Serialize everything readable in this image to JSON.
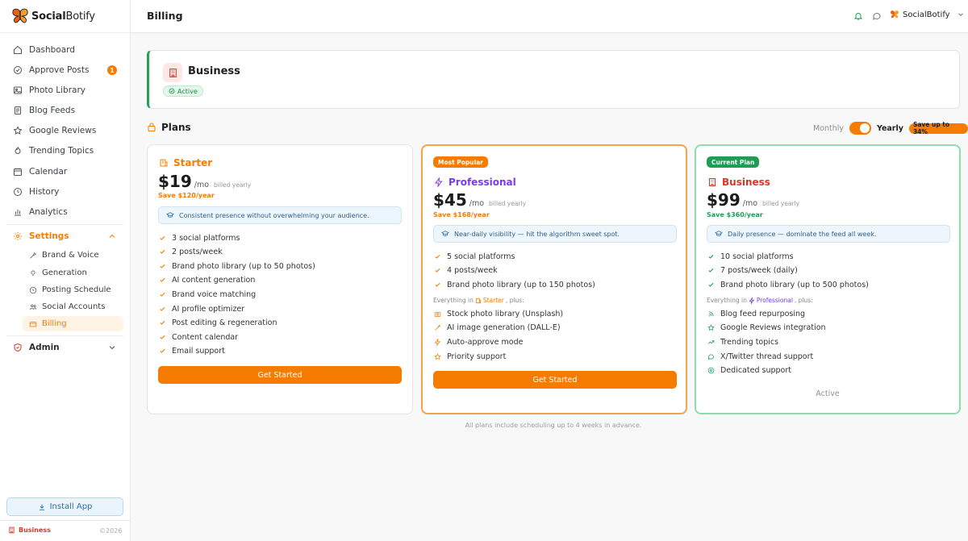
{
  "app": {
    "brand_bold": "Social",
    "brand_rest": "Botify"
  },
  "sidebar": {
    "items": [
      {
        "label": "Dashboard",
        "icon": "home-icon"
      },
      {
        "label": "Approve Posts",
        "icon": "check-circle-icon",
        "badge": "1"
      },
      {
        "label": "Photo Library",
        "icon": "image-icon"
      },
      {
        "label": "Blog Feeds",
        "icon": "document-icon"
      },
      {
        "label": "Google Reviews",
        "icon": "star-icon"
      },
      {
        "label": "Trending Topics",
        "icon": "trend-icon"
      },
      {
        "label": "Calendar",
        "icon": "calendar-icon"
      },
      {
        "label": "History",
        "icon": "clock-icon"
      },
      {
        "label": "Analytics",
        "icon": "bar-chart-icon"
      }
    ],
    "settings": {
      "label": "Settings",
      "sub_items": [
        {
          "label": "Brand & Voice"
        },
        {
          "label": "Generation"
        },
        {
          "label": "Posting Schedule"
        },
        {
          "label": "Social Accounts"
        },
        {
          "label": "Billing"
        }
      ]
    },
    "admin": {
      "label": "Admin"
    },
    "install_label": "Install App",
    "footer_plan": "Business",
    "footer_copy": "©2026"
  },
  "header": {
    "title": "Billing",
    "user_name": "SocialBotify"
  },
  "current_plan": {
    "name": "Business",
    "status": "Active"
  },
  "plans_section": {
    "title": "Plans",
    "toggle": {
      "monthly": "Monthly",
      "yearly": "Yearly",
      "save": "Save up to 34%"
    },
    "footnote": "All plans include scheduling up to 4 weeks in advance."
  },
  "plans": {
    "starter": {
      "name": "Starter",
      "price": "$19",
      "per": "/mo",
      "billed": "billed yearly",
      "save": "Save $120/year",
      "tagline": "Consistent presence without overwhelming your audience.",
      "features": [
        "3 social platforms",
        "2 posts/week",
        "Brand photo library (up to 50 photos)",
        "AI content generation",
        "Brand voice matching",
        "AI profile optimizer",
        "Post editing & regeneration",
        "Content calendar",
        "Email support"
      ],
      "cta": "Get Started"
    },
    "professional": {
      "ribbon": "Most Popular",
      "name": "Professional",
      "price": "$45",
      "per": "/mo",
      "billed": "billed yearly",
      "save": "Save $168/year",
      "tagline": "Near-daily visibility — hit the algorithm sweet spot.",
      "features": [
        "5 social platforms",
        "4 posts/week",
        "Brand photo library (up to 150 photos)"
      ],
      "everything_prefix": "Everything in",
      "everything_ref": "Starter",
      "everything_suffix": ", plus:",
      "extras": [
        "Stock photo library (Unsplash)",
        "AI image generation (DALL-E)",
        "Auto-approve mode",
        "Priority support"
      ],
      "cta": "Get Started"
    },
    "business": {
      "ribbon": "Current Plan",
      "name": "Business",
      "price": "$99",
      "per": "/mo",
      "billed": "billed yearly",
      "save": "Save $360/year",
      "tagline": "Daily presence — dominate the feed all week.",
      "features": [
        "10 social platforms",
        "7 posts/week (daily)",
        "Brand photo library (up to 500 photos)"
      ],
      "everything_prefix": "Everything in",
      "everything_ref": "Professional",
      "everything_suffix": ", plus:",
      "extras": [
        "Blog feed repurposing",
        "Google Reviews integration",
        "Trending topics",
        "X/Twitter thread support",
        "Dedicated support"
      ],
      "active_label": "Active"
    }
  },
  "colors": {
    "accent": "#f57c00",
    "success": "#1f9d55",
    "business_red": "#d9362b",
    "pro_purple": "#7c3aed"
  }
}
